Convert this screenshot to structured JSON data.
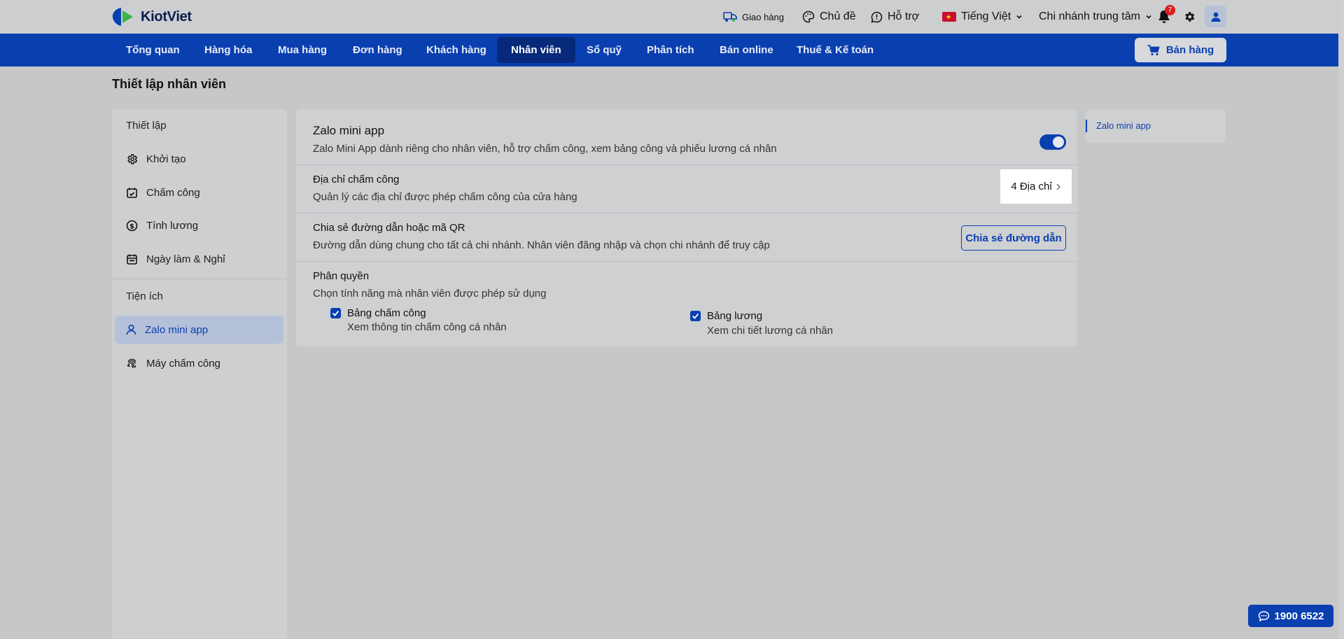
{
  "brand": {
    "name": "KiotViet",
    "green": "#3bb54a",
    "blue": "#0a3fb0"
  },
  "topbar": {
    "delivery": "Giao hàng",
    "theme": "Chủ đề",
    "support": "Hỗ trợ",
    "language": "Tiếng Việt",
    "branch": "Chi nhánh trung tâm",
    "notification_count": "7"
  },
  "nav": {
    "items": [
      "Tổng quan",
      "Hàng hóa",
      "Mua hàng",
      "Đơn hàng",
      "Khách hàng",
      "Nhân viên",
      "Sổ quỹ",
      "Phân tích",
      "Bán online",
      "Thuế & Kế toán"
    ],
    "active": "Nhân viên",
    "sell_label": "Bán hàng"
  },
  "page": {
    "title": "Thiết lập nhân viên"
  },
  "sidebar": {
    "section_setup": "Thiết lập",
    "items_setup": [
      {
        "label": "Khởi tạo",
        "icon": "gear-icon"
      },
      {
        "label": "Chấm công",
        "icon": "calendar-check-icon"
      },
      {
        "label": "Tính lương",
        "icon": "dollar-icon"
      },
      {
        "label": "Ngày làm & Nghỉ",
        "icon": "calendar-icon"
      }
    ],
    "section_utils": "Tiện ích",
    "items_utils": [
      {
        "label": "Zalo mini app",
        "icon": "user-icon",
        "active": true
      },
      {
        "label": "Máy chấm công",
        "icon": "fingerprint-icon"
      }
    ]
  },
  "main": {
    "zalo": {
      "title": "Zalo mini app",
      "desc": "Zalo Mini App dành riêng cho nhân viên, hỗ trợ chấm công, xem bảng công và phiếu lương cá nhân",
      "enabled": true
    },
    "address": {
      "title": "Địa chỉ chấm công",
      "desc": "Quản lý các địa chỉ được phép chấm công của cửa hàng",
      "count_label": "4 Địa chỉ"
    },
    "share": {
      "title": "Chia sẻ đường dẫn hoặc mã QR",
      "desc": "Đường dẫn dùng chung cho tất cả chi nhánh. Nhân viên đăng nhập và chọn chi nhánh để truy cập",
      "button": "Chia sẻ đường dẫn"
    },
    "permissions": {
      "title": "Phân quyền",
      "desc": "Chọn tính năng mà nhân viên được phép sử dụng",
      "options": [
        {
          "label": "Bảng chấm công",
          "desc": "Xem thông tin chấm công cá nhân",
          "checked": true
        },
        {
          "label": "Bảng lương",
          "desc": "Xem chi tiết lương cá nhân",
          "checked": true
        }
      ]
    }
  },
  "anchor": {
    "item": "Zalo mini app"
  },
  "hotline": {
    "number": "1900 6522"
  }
}
